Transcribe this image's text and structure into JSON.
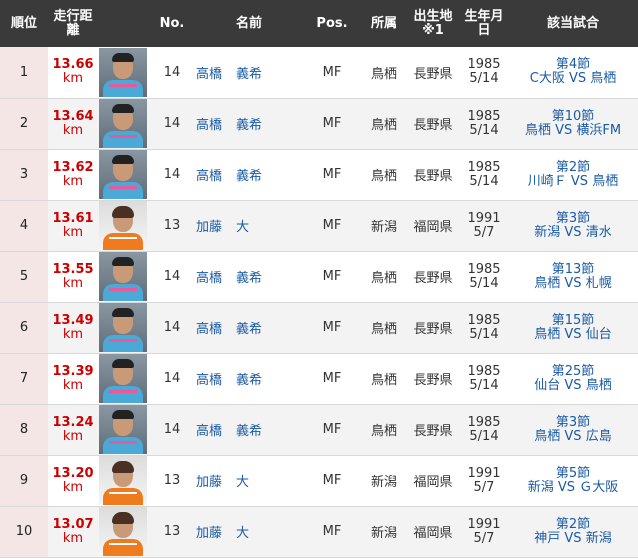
{
  "headers": {
    "rank": "順位",
    "distance": "走行距離",
    "photo": "",
    "number": "No.",
    "name": "名前",
    "position": "Pos.",
    "club": "所属",
    "birthplace": "出生地※1",
    "birthdate": "生年月日",
    "match": "該当試合"
  },
  "rows": [
    {
      "rank": "1",
      "distance": "13.66",
      "unit": "km",
      "player": "A",
      "number": "14",
      "family": "高橋",
      "given": "義希",
      "position": "MF",
      "club": "鳥栖",
      "birthplace": "長野県",
      "birth_year": "1985",
      "birth_md": "5/14",
      "match_round": "第4節",
      "match_teams": "C大阪 VS 鳥栖"
    },
    {
      "rank": "2",
      "distance": "13.64",
      "unit": "km",
      "player": "A",
      "number": "14",
      "family": "高橋",
      "given": "義希",
      "position": "MF",
      "club": "鳥栖",
      "birthplace": "長野県",
      "birth_year": "1985",
      "birth_md": "5/14",
      "match_round": "第10節",
      "match_teams": "鳥栖 VS 横浜FM"
    },
    {
      "rank": "3",
      "distance": "13.62",
      "unit": "km",
      "player": "A",
      "number": "14",
      "family": "高橋",
      "given": "義希",
      "position": "MF",
      "club": "鳥栖",
      "birthplace": "長野県",
      "birth_year": "1985",
      "birth_md": "5/14",
      "match_round": "第2節",
      "match_teams": "川崎Ｆ VS 鳥栖"
    },
    {
      "rank": "4",
      "distance": "13.61",
      "unit": "km",
      "player": "B",
      "number": "13",
      "family": "加藤",
      "given": "大",
      "position": "MF",
      "club": "新潟",
      "birthplace": "福岡県",
      "birth_year": "1991",
      "birth_md": "5/7",
      "match_round": "第3節",
      "match_teams": "新潟 VS 清水"
    },
    {
      "rank": "5",
      "distance": "13.55",
      "unit": "km",
      "player": "A",
      "number": "14",
      "family": "高橋",
      "given": "義希",
      "position": "MF",
      "club": "鳥栖",
      "birthplace": "長野県",
      "birth_year": "1985",
      "birth_md": "5/14",
      "match_round": "第13節",
      "match_teams": "鳥栖 VS 札幌"
    },
    {
      "rank": "6",
      "distance": "13.49",
      "unit": "km",
      "player": "A",
      "number": "14",
      "family": "高橋",
      "given": "義希",
      "position": "MF",
      "club": "鳥栖",
      "birthplace": "長野県",
      "birth_year": "1985",
      "birth_md": "5/14",
      "match_round": "第15節",
      "match_teams": "鳥栖 VS 仙台"
    },
    {
      "rank": "7",
      "distance": "13.39",
      "unit": "km",
      "player": "A",
      "number": "14",
      "family": "高橋",
      "given": "義希",
      "position": "MF",
      "club": "鳥栖",
      "birthplace": "長野県",
      "birth_year": "1985",
      "birth_md": "5/14",
      "match_round": "第25節",
      "match_teams": "仙台 VS 鳥栖"
    },
    {
      "rank": "8",
      "distance": "13.24",
      "unit": "km",
      "player": "A",
      "number": "14",
      "family": "高橋",
      "given": "義希",
      "position": "MF",
      "club": "鳥栖",
      "birthplace": "長野県",
      "birth_year": "1985",
      "birth_md": "5/14",
      "match_round": "第3節",
      "match_teams": "鳥栖 VS 広島"
    },
    {
      "rank": "9",
      "distance": "13.20",
      "unit": "km",
      "player": "B",
      "number": "13",
      "family": "加藤",
      "given": "大",
      "position": "MF",
      "club": "新潟",
      "birthplace": "福岡県",
      "birth_year": "1991",
      "birth_md": "5/7",
      "match_round": "第5節",
      "match_teams": "新潟 VS Ｇ大阪"
    },
    {
      "rank": "10",
      "distance": "13.07",
      "unit": "km",
      "player": "B",
      "number": "13",
      "family": "加藤",
      "given": "大",
      "position": "MF",
      "club": "新潟",
      "birthplace": "福岡県",
      "birth_year": "1991",
      "birth_md": "5/7",
      "match_round": "第2節",
      "match_teams": "神戸 VS 新潟"
    }
  ]
}
